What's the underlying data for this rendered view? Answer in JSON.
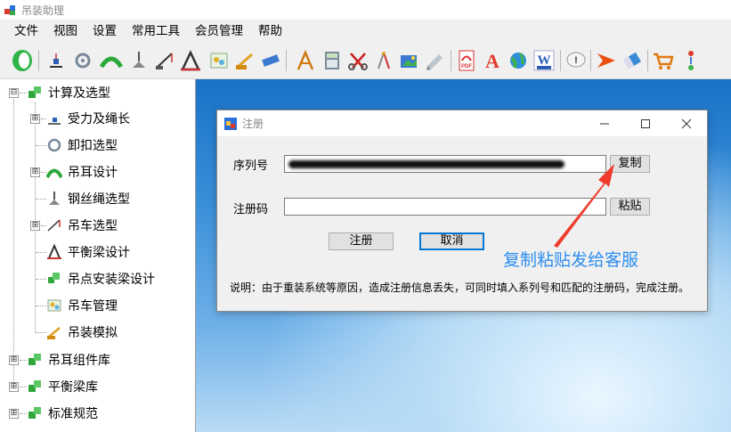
{
  "window": {
    "title": "吊装助理",
    "icon": "app-blocks-icon"
  },
  "menu": [
    "文件",
    "视图",
    "设置",
    "常用工具",
    "会员管理",
    "帮助"
  ],
  "toolbar_icons": [
    "green-toggle-icon",
    "load-icon",
    "shackle-icon",
    "lifting-lug-icon",
    "wire-rope-icon",
    "crane-icon",
    "spreader-beam-icon",
    "chart-icon",
    "truck-crane-icon",
    "ruler-icon",
    "table-icon",
    "pen-icon",
    "calculator-icon",
    "scissors-icon",
    "compass-icon",
    "image-icon",
    "pencil-icon",
    "pdf-icon",
    "text-a-icon",
    "globe-icon",
    "word-icon",
    "speech-icon",
    "arrow-icon",
    "eraser-icon",
    "cart-icon",
    "settings-icon"
  ],
  "tree": {
    "root": {
      "label": "计算及选型",
      "expander": "⊟"
    },
    "children": [
      {
        "label": "受力及绳长",
        "expander": "⊞",
        "icon": "force-icon"
      },
      {
        "label": "卸扣选型",
        "expander": "",
        "icon": "shackle-icon"
      },
      {
        "label": "吊耳设计",
        "expander": "⊞",
        "icon": "lifting-lug-icon"
      },
      {
        "label": "钢丝绳选型",
        "expander": "",
        "icon": "wire-rope-icon"
      },
      {
        "label": "吊车选型",
        "expander": "⊞",
        "icon": "crane-icon"
      },
      {
        "label": "平衡梁设计",
        "expander": "",
        "icon": "spreader-beam-icon"
      },
      {
        "label": "吊点安装梁设计",
        "expander": "",
        "icon": "beam-install-icon"
      },
      {
        "label": "吊车管理",
        "expander": "",
        "icon": "crane-manage-icon"
      },
      {
        "label": "吊装模拟",
        "expander": "",
        "icon": "simulation-icon"
      }
    ],
    "others": [
      {
        "label": "吊耳组件库",
        "expander": "⊞"
      },
      {
        "label": "平衡梁库",
        "expander": "⊞"
      },
      {
        "label": "标准规范",
        "expander": "⊞"
      }
    ]
  },
  "dialog": {
    "title": "注册",
    "serial_label": "序列号",
    "copy_button": "复制",
    "regcode_label": "注册码",
    "regcode_value": "",
    "paste_button": "粘贴",
    "register_button": "注册",
    "cancel_button": "取消",
    "note": "说明：由于重装系统等原因，造成注册信息丢失，可同时填入系列号和匹配的注册码，完成注册。"
  },
  "annotation": {
    "text": "复制粘贴发给客服",
    "color": "#ef3b2e"
  }
}
